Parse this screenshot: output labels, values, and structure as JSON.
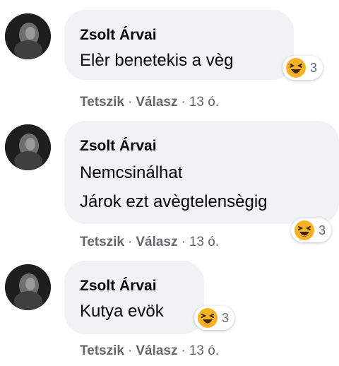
{
  "comments": [
    {
      "author": "Zsolt Árvai",
      "lines": [
        "Elèr benetekis a vèg"
      ],
      "reaction": {
        "icon": "haha-icon",
        "count": "3"
      },
      "actions": {
        "like": "Tetszik",
        "reply": "Válasz",
        "sep": "·",
        "time": "13 ó."
      }
    },
    {
      "author": "Zsolt Árvai",
      "lines": [
        "Nemcsinálhat",
        "Járok ezt avègtelensègig"
      ],
      "reaction": {
        "icon": "haha-icon",
        "count": "3"
      },
      "actions": {
        "like": "Tetszik",
        "reply": "Válasz",
        "sep": "·",
        "time": "13 ó."
      }
    },
    {
      "author": "Zsolt Árvai",
      "lines": [
        "Kutya evök"
      ],
      "reaction": {
        "icon": "haha-icon",
        "count": "3"
      },
      "actions": {
        "like": "Tetszik",
        "reply": "Válasz",
        "sep": "·",
        "time": "13 ó."
      }
    }
  ],
  "colors": {
    "bubble": "#f0f2f5",
    "text": "#050505",
    "secondary": "#65676b",
    "haha": "#f7b125"
  }
}
